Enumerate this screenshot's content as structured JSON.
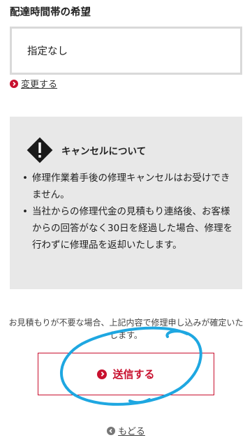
{
  "delivery": {
    "heading": "配達時間帯の希望",
    "value": "指定なし",
    "change_link": "変更する"
  },
  "cancel_notice": {
    "title": "キャンセルについて",
    "items": [
      "修理作業着手後の修理キャンセルはお受けできません。",
      "当社からの修理代金の見積もり連絡後、お客様からの回答がなく30日を経過した場合、修理を行わずに修理品を返却いたします。"
    ]
  },
  "confirm_text": "お見積もりが不要な場合、上記内容で修理申し込みが確定いたします。",
  "submit_label": "送信する",
  "back_label": "もどる",
  "colors": {
    "accent": "#c8102e",
    "annotation": "#1ea7e1",
    "notice_bg": "#e8e8e8"
  },
  "icons": {
    "change": "chevron-right-circle-icon",
    "warning": "warning-diamond-icon",
    "submit": "chevron-right-circle-icon",
    "back": "chevron-left-circle-icon"
  }
}
